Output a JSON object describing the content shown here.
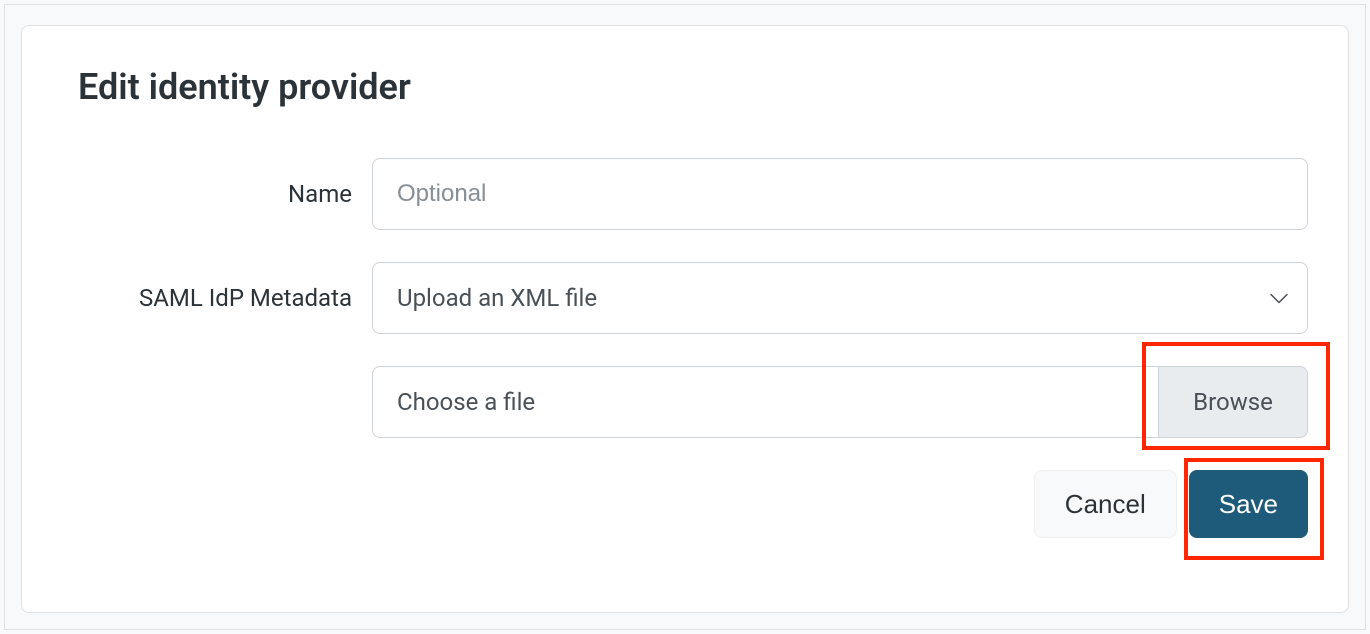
{
  "page": {
    "title": "Edit identity provider"
  },
  "form": {
    "name": {
      "label": "Name",
      "placeholder": "Optional",
      "value": ""
    },
    "metadata": {
      "label": "SAML IdP Metadata",
      "selected": "Upload an XML file"
    },
    "file": {
      "placeholder": "Choose a file",
      "browse_label": "Browse"
    }
  },
  "actions": {
    "cancel": "Cancel",
    "save": "Save"
  }
}
